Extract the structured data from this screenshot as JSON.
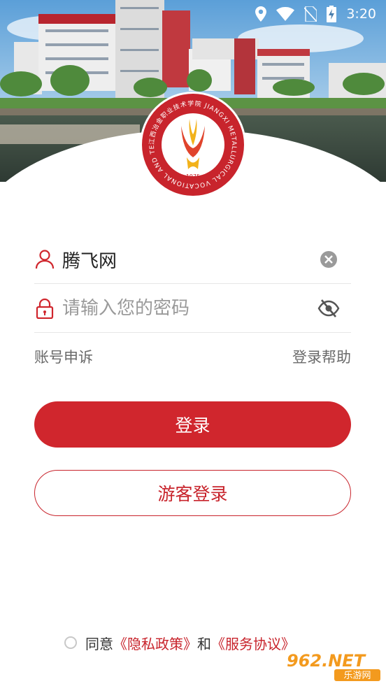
{
  "status_bar": {
    "time": "3:20"
  },
  "logo": {
    "seal_text": "江西冶金职业技术学院 JIANGXI METALLURGICAL VOCATIONAL AND TECHNICAL COLLEGE",
    "year": "1975"
  },
  "form": {
    "username_value": "腾飞网",
    "password_placeholder": "请输入您的密码"
  },
  "links": {
    "appeal": "账号申诉",
    "help": "登录帮助"
  },
  "buttons": {
    "login": "登录",
    "guest": "游客登录"
  },
  "agreement": {
    "agree": "同意",
    "privacy": "《隐私政策》",
    "and": "和",
    "service": "《服务协议》"
  },
  "watermark": {
    "brand": "962.NET",
    "sub": "乐游网"
  },
  "icons": [
    "location-icon",
    "wifi-icon",
    "no-sim-icon",
    "battery-charging-icon",
    "user-icon",
    "lock-icon",
    "clear-icon",
    "eye-off-icon"
  ],
  "colors": {
    "accent": "#d0262d",
    "text_gray": "#6a6a6a",
    "divider": "#e6e6e6"
  }
}
